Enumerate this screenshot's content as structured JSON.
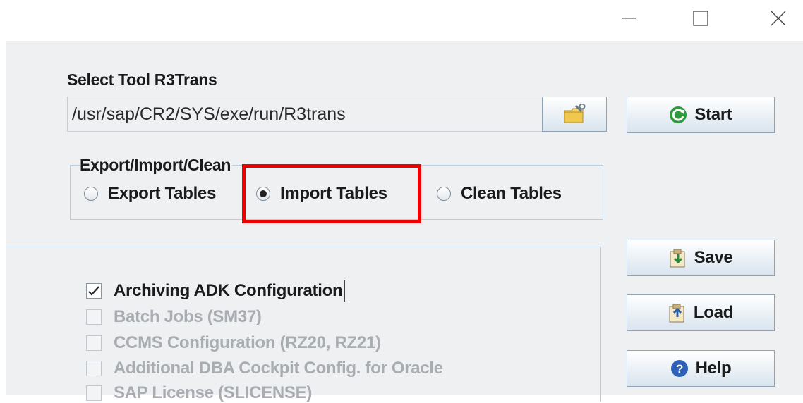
{
  "window": {
    "minimize_icon": "minimize-icon",
    "maximize_icon": "maximize-icon",
    "close_icon": "close-icon"
  },
  "tool": {
    "label": "Select Tool R3Trans",
    "path": "/usr/sap/CR2/SYS/exe/run/R3trans",
    "browse_icon": "folder-wrench-icon"
  },
  "buttons": {
    "start": "Start",
    "save": "Save",
    "load": "Load",
    "help": "Help"
  },
  "mode": {
    "title": "Export/Import/Clean",
    "options": [
      "Export Tables",
      "Import Tables",
      "Clean Tables"
    ],
    "selected": "Import Tables"
  },
  "items": [
    {
      "label": "Archiving ADK Configuration",
      "checked": true,
      "enabled": true
    },
    {
      "label": "Batch Jobs (SM37)",
      "checked": false,
      "enabled": false
    },
    {
      "label": "CCMS Configuration (RZ20, RZ21)",
      "checked": false,
      "enabled": false
    },
    {
      "label": "Additional DBA Cockpit Config. for Oracle",
      "checked": false,
      "enabled": false
    },
    {
      "label": "SAP License (SLICENSE)",
      "checked": false,
      "enabled": false
    }
  ],
  "colors": {
    "highlight": "#ee0000",
    "panel": "#eef0f2",
    "disabled_text": "#a9acb0"
  }
}
